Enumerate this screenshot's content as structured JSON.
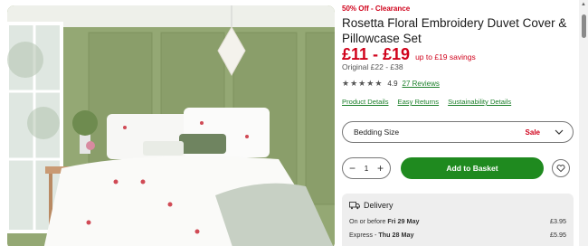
{
  "product": {
    "promo": "50% Off - Clearance",
    "title": "Rosetta Floral Embroidery Duvet Cover & Pillowcase Set",
    "price": "£11 - £19",
    "savings": "up to £19 savings",
    "original": "Original £22 - £38",
    "rating": "4.9",
    "reviews": "27 Reviews"
  },
  "links": {
    "details": "Product Details",
    "returns": "Easy Returns",
    "sustainability": "Sustainability Details"
  },
  "size_select": {
    "label": "Bedding Size",
    "badge": "Sale"
  },
  "purchase": {
    "quantity": "1",
    "add_label": "Add to Basket"
  },
  "delivery": {
    "heading": "Delivery",
    "options": [
      {
        "label": "On or before",
        "date": "Fri 29 May",
        "price": "£3.95"
      },
      {
        "label": "Express - ",
        "date": "Thu 28 May",
        "price": "£5.95"
      }
    ]
  },
  "icons": {
    "star": "star-icon",
    "chevron": "chevron-down-icon",
    "heart": "heart-icon",
    "truck": "truck-icon"
  },
  "colors": {
    "sale_red": "#d0021b",
    "link_green": "#1b7f2a",
    "button_green": "#1f8a1f",
    "wall_green": "#8fa36d"
  }
}
